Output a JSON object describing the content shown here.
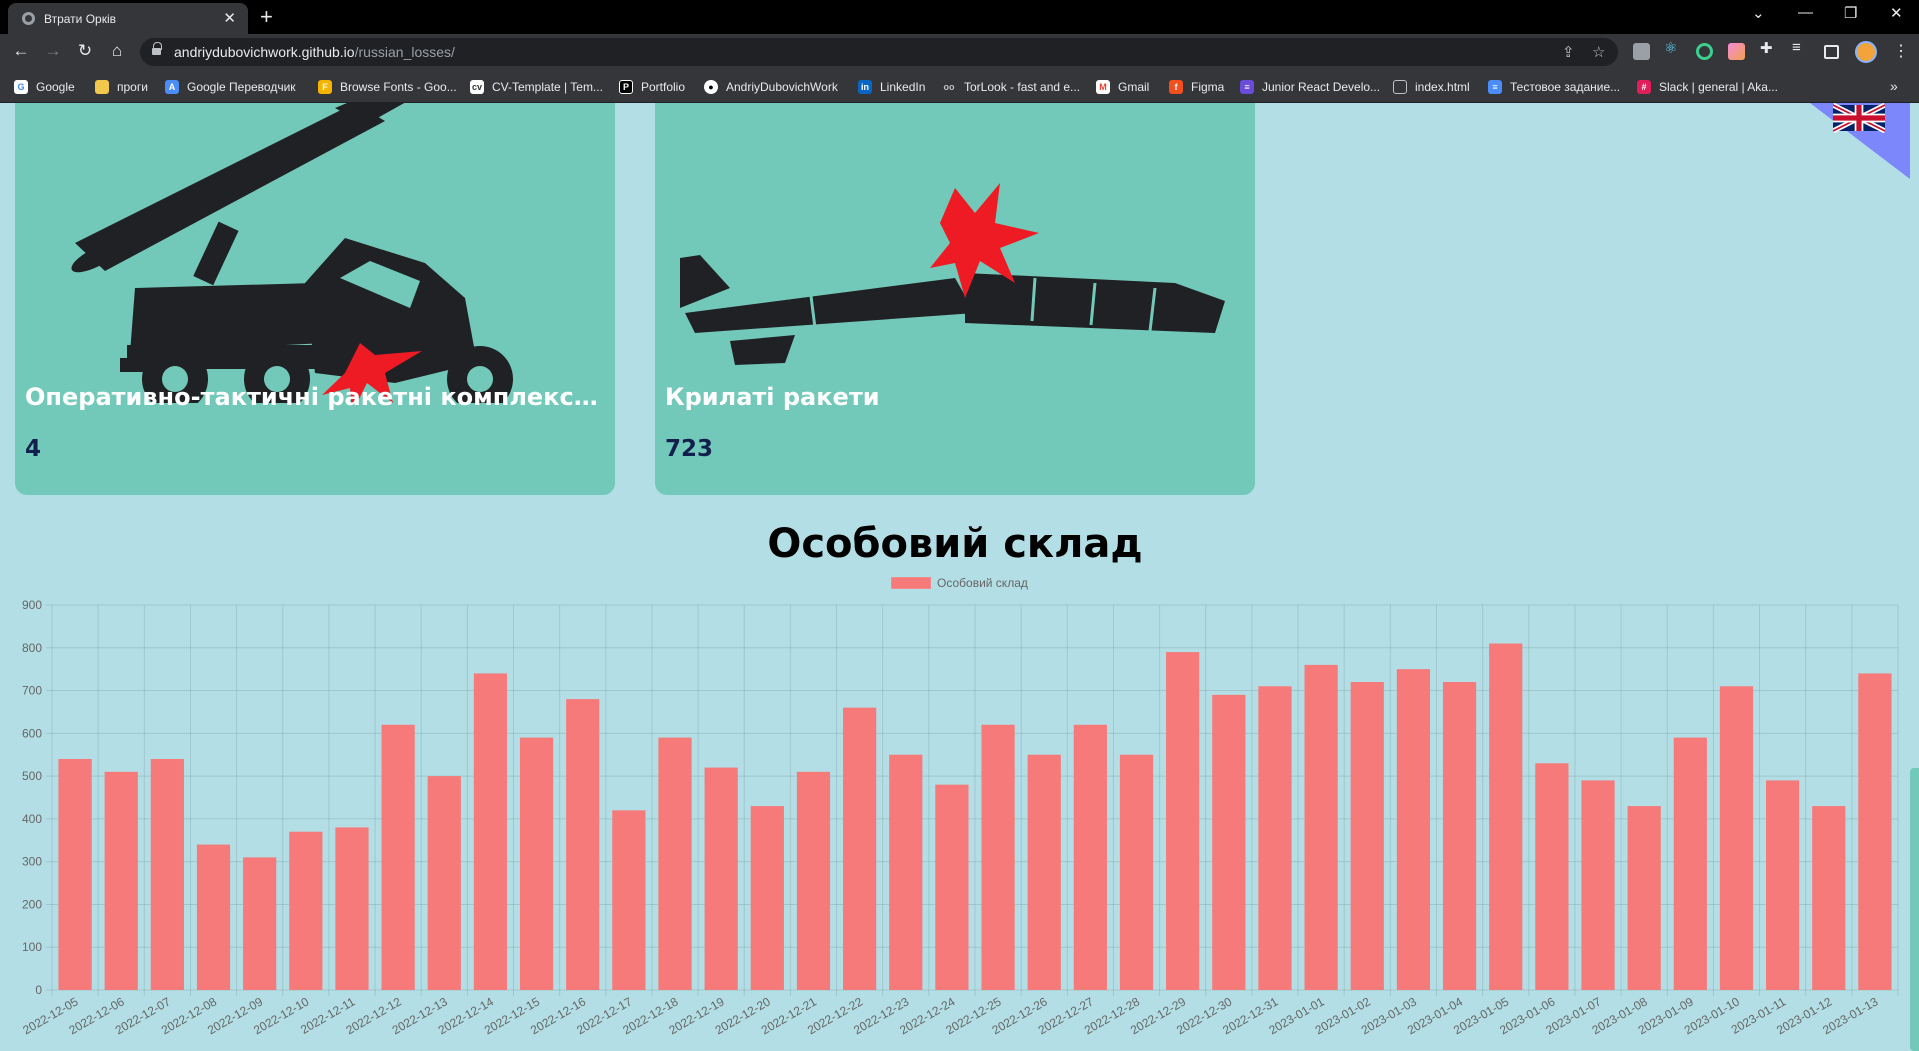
{
  "browser": {
    "tab_title": "Втрати Орків",
    "url_host": "andriydubovichwork.github.io",
    "url_path": "/russian_losses/"
  },
  "bookmarks": [
    {
      "label": "Google",
      "icon": "google-icon",
      "color": "#ffffff"
    },
    {
      "label": "проги",
      "icon": "folder-icon",
      "color": "#f1c84b"
    },
    {
      "label": "Google Переводчик",
      "icon": "translate-icon",
      "color": "#4b8df8"
    },
    {
      "label": "Browse Fonts - Goo...",
      "icon": "fonts-icon",
      "color": "#f5b400"
    },
    {
      "label": "CV-Template | Tem...",
      "icon": "cv-icon",
      "color": "#ffffff"
    },
    {
      "label": "Portfolio",
      "icon": "portfolio-icon",
      "color": "#000000"
    },
    {
      "label": "AndriyDubovichWork",
      "icon": "github-icon",
      "color": "#ffffff"
    },
    {
      "label": "LinkedIn",
      "icon": "linkedin-icon",
      "color": "#0a66c2"
    },
    {
      "label": "TorLook - fast and e...",
      "icon": "torlook-icon",
      "color": "#bdc1c6"
    },
    {
      "label": "Gmail",
      "icon": "gmail-icon",
      "color": "#ea4335"
    },
    {
      "label": "Figma",
      "icon": "figma-icon",
      "color": "#f24e1e"
    },
    {
      "label": "Junior React Develo...",
      "icon": "job-icon",
      "color": "#6a4cd8"
    },
    {
      "label": "index.html",
      "icon": "html-file-icon",
      "color": "#bdc1c6"
    },
    {
      "label": "Тестовое задание...",
      "icon": "docs-icon",
      "color": "#4b8df8"
    },
    {
      "label": "Slack | general | Aka...",
      "icon": "slack-icon",
      "color": "#e01e5a"
    }
  ],
  "cards": [
    {
      "title": "Оперативно-тактичні ракетні комплекси т...",
      "count": "4",
      "icon": "missile-launcher-truck-icon"
    },
    {
      "title": "Крилаті ракети",
      "count": "723",
      "icon": "cruise-missile-icon"
    }
  ],
  "language_flag": "uk-flag-icon",
  "section_title": "Особовий склад",
  "colors": {
    "bar": "#f77a7a",
    "card": "#73c9b9",
    "page": "#b3dee5",
    "flag_corner": "#7b87fa"
  },
  "chart_data": {
    "type": "bar",
    "legend": "Особовий склад",
    "legend_position": "top-center",
    "grid": true,
    "ylim": [
      0,
      900
    ],
    "yticks": [
      0,
      100,
      200,
      300,
      400,
      500,
      600,
      700,
      800,
      900
    ],
    "categories": [
      "2022-12-05",
      "2022-12-06",
      "2022-12-07",
      "2022-12-08",
      "2022-12-09",
      "2022-12-10",
      "2022-12-11",
      "2022-12-12",
      "2022-12-13",
      "2022-12-14",
      "2022-12-15",
      "2022-12-16",
      "2022-12-17",
      "2022-12-18",
      "2022-12-19",
      "2022-12-20",
      "2022-12-21",
      "2022-12-22",
      "2022-12-23",
      "2022-12-24",
      "2022-12-25",
      "2022-12-26",
      "2022-12-27",
      "2022-12-28",
      "2022-12-29",
      "2022-12-30",
      "2022-12-31",
      "2023-01-01",
      "2023-01-02",
      "2023-01-03",
      "2023-01-04",
      "2023-01-05",
      "2023-01-06",
      "2023-01-07",
      "2023-01-08",
      "2023-01-09",
      "2023-01-10",
      "2023-01-11",
      "2023-01-12",
      "2023-01-13"
    ],
    "series": [
      {
        "name": "Особовий склад",
        "values": [
          540,
          510,
          540,
          340,
          310,
          370,
          380,
          620,
          500,
          740,
          590,
          680,
          420,
          590,
          520,
          430,
          510,
          660,
          550,
          480,
          620,
          550,
          620,
          550,
          790,
          690,
          710,
          760,
          720,
          750,
          720,
          810,
          530,
          490,
          430,
          590,
          710,
          490,
          430,
          740
        ]
      }
    ]
  }
}
